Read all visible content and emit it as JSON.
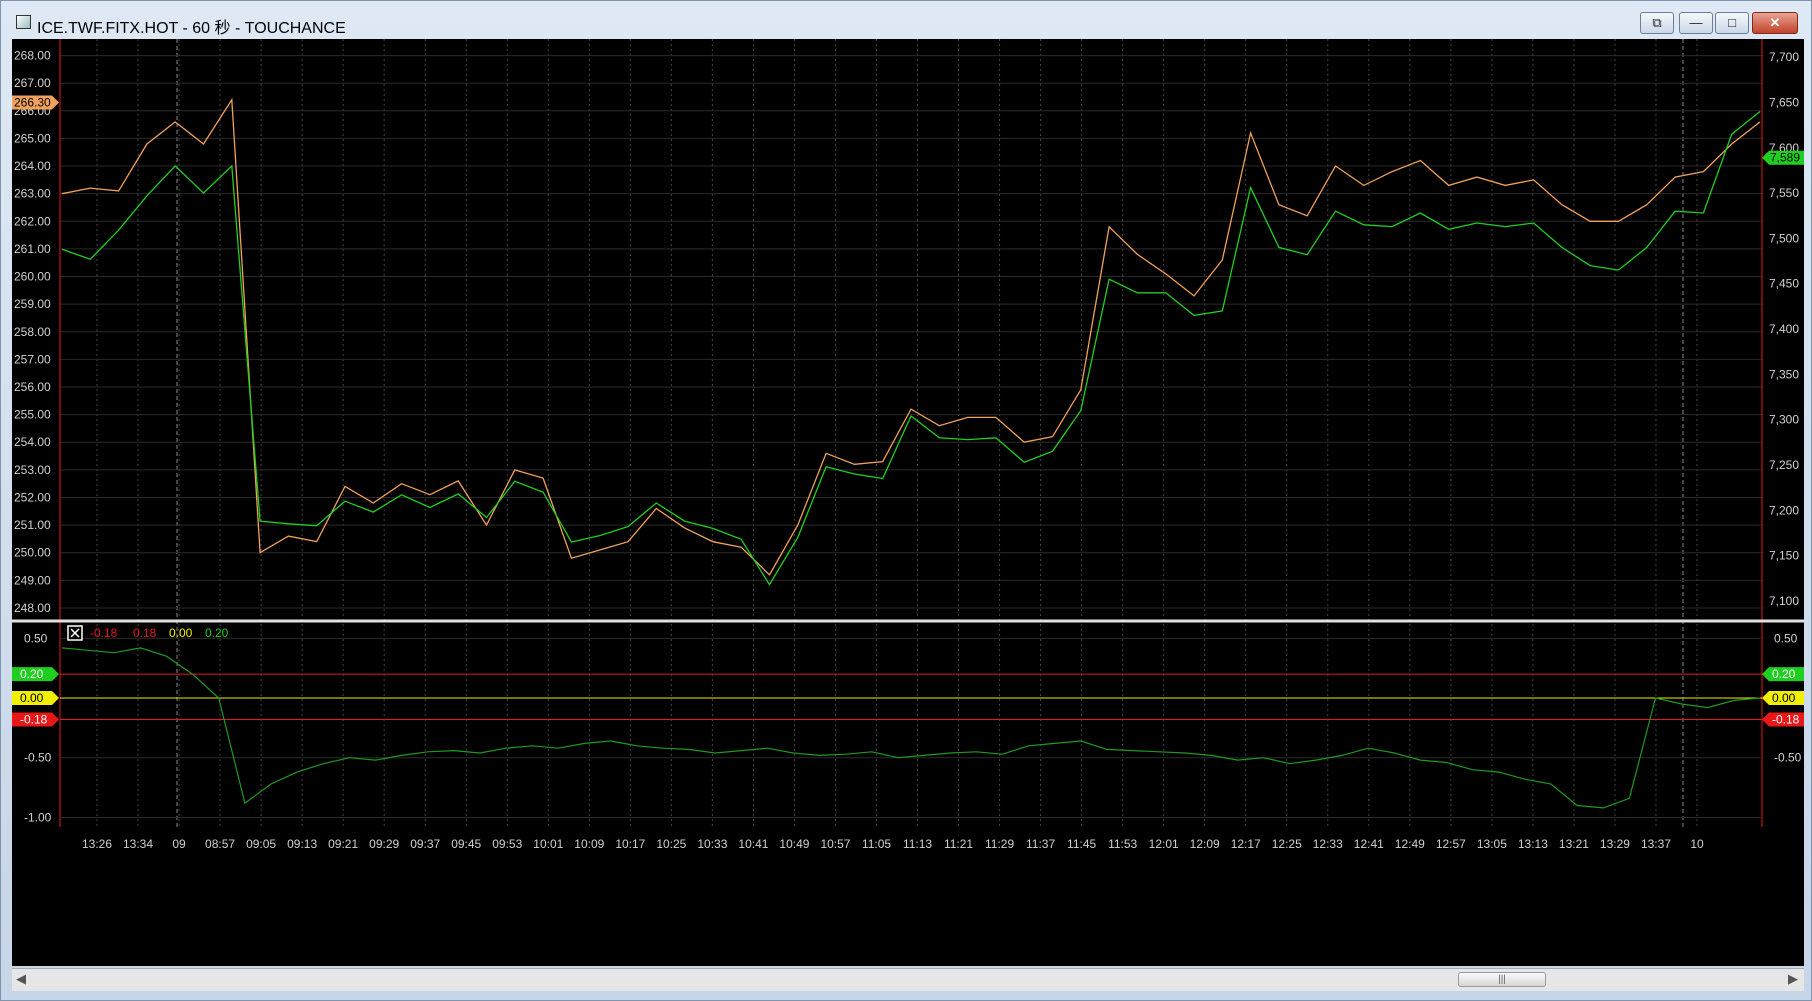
{
  "window": {
    "title": "ICE.TWF.FITX.HOT - 60 秒 - TOUCHANCE",
    "icon": "chart-app-icon",
    "buttons": {
      "restore_extra": "⧉",
      "minimize": "—",
      "maximize": "□",
      "close": "✕"
    }
  },
  "colors": {
    "orange": "#f0a15a",
    "green": "#1fcf1f",
    "red": "#e81818",
    "yellow": "#f0f000",
    "grid": "#444444",
    "axis_text": "#d0d0d0",
    "background": "#000000"
  },
  "chart_data": [
    {
      "type": "line",
      "panel": "main",
      "x_labels": [
        "13:26",
        "13:34",
        "09",
        "08:57",
        "09:05",
        "09:13",
        "09:21",
        "09:29",
        "09:37",
        "09:45",
        "09:53",
        "10:01",
        "10:09",
        "10:17",
        "10:25",
        "10:33",
        "10:41",
        "10:49",
        "10:57",
        "11:05",
        "11:13",
        "11:21",
        "11:29",
        "11:37",
        "11:45",
        "11:53",
        "12:01",
        "12:09",
        "12:17",
        "12:25",
        "12:33",
        "12:41",
        "12:49",
        "12:57",
        "13:05",
        "13:13",
        "13:21",
        "13:29",
        "13:37",
        "10"
      ],
      "left_axis": {
        "ticks": [
          "268.00",
          "267.00",
          "266.00",
          "265.00",
          "264.00",
          "263.00",
          "262.00",
          "261.00",
          "260.00",
          "259.00",
          "258.00",
          "257.00",
          "256.00",
          "255.00",
          "254.00",
          "253.00",
          "252.00",
          "251.00",
          "250.00",
          "249.00",
          "248.00"
        ],
        "ylim": [
          247.6,
          268.6
        ]
      },
      "right_axis": {
        "ticks": [
          "7,700",
          "7,650",
          "7,600",
          "7,550",
          "7,500",
          "7,450",
          "7,400",
          "7,350",
          "7,300",
          "7,250",
          "7,200",
          "7,150",
          "7,100"
        ],
        "ylim": [
          7080,
          7720
        ]
      },
      "last_value_labels": {
        "left": "266.30",
        "right": "7,589"
      },
      "series": [
        {
          "color": "#f0a15a",
          "axis": "left",
          "values": [
            263.0,
            263.2,
            263.1,
            264.8,
            265.6,
            264.8,
            266.4,
            250.0,
            250.6,
            250.4,
            252.4,
            251.8,
            252.5,
            252.1,
            252.6,
            251.0,
            253.0,
            252.7,
            249.8,
            250.1,
            250.4,
            251.6,
            250.9,
            250.4,
            250.2,
            249.2,
            251.0,
            253.6,
            253.2,
            253.3,
            255.2,
            254.6,
            254.9,
            254.9,
            254.0,
            254.2,
            255.9,
            261.8,
            260.8,
            260.1,
            259.3,
            260.6,
            265.2,
            262.6,
            262.2,
            264.0,
            263.3,
            263.8,
            264.2,
            263.3,
            263.6,
            263.3,
            263.5,
            262.6,
            262.0,
            262.0,
            262.6,
            263.6,
            263.8,
            264.8,
            265.6
          ]
        },
        {
          "color": "#1fcf1f",
          "axis": "right",
          "values": [
            7488,
            7477,
            7509,
            7547,
            7580,
            7550,
            7580,
            7188,
            7185,
            7183,
            7210,
            7198,
            7217,
            7203,
            7218,
            7192,
            7232,
            7220,
            7165,
            7172,
            7182,
            7208,
            7188,
            7180,
            7168,
            7118,
            7170,
            7248,
            7240,
            7235,
            7304,
            7280,
            7278,
            7280,
            7253,
            7265,
            7310,
            7455,
            7440,
            7440,
            7415,
            7420,
            7556,
            7490,
            7482,
            7530,
            7515,
            7513,
            7528,
            7510,
            7517,
            7513,
            7517,
            7490,
            7470,
            7465,
            7490,
            7530,
            7528,
            7615,
            7640
          ]
        }
      ]
    },
    {
      "type": "line",
      "panel": "indicator",
      "legend": [
        "-0.18",
        "0.18",
        "0.00",
        "0.20"
      ],
      "legend_colors": [
        "#e81818",
        "#e81818",
        "#f0f000",
        "#1fcf1f"
      ],
      "left_axis": {
        "ticks": [
          "0.50",
          "-0.50",
          "-1.00"
        ],
        "ylim": [
          -1.08,
          0.62
        ]
      },
      "right_axis": {
        "ticks": [
          "0.50",
          "-0.50"
        ]
      },
      "reference_lines": [
        {
          "value": 0.2,
          "label": "0.20",
          "color": "#1fcf1f",
          "line_color": "#e81818"
        },
        {
          "value": 0.0,
          "label": "0.00",
          "color": "#f0f000",
          "line_color": "#f0f000"
        },
        {
          "value": -0.18,
          "label": "-0.18",
          "color": "#e81818",
          "line_color": "#e81818"
        }
      ],
      "series": [
        {
          "color": "#1f9a1f",
          "values": [
            0.42,
            0.4,
            0.38,
            0.42,
            0.35,
            0.2,
            0.0,
            -0.88,
            -0.72,
            -0.62,
            -0.55,
            -0.5,
            -0.52,
            -0.48,
            -0.45,
            -0.44,
            -0.46,
            -0.42,
            -0.4,
            -0.42,
            -0.38,
            -0.36,
            -0.4,
            -0.42,
            -0.43,
            -0.46,
            -0.44,
            -0.42,
            -0.46,
            -0.48,
            -0.47,
            -0.45,
            -0.5,
            -0.48,
            -0.46,
            -0.45,
            -0.47,
            -0.4,
            -0.38,
            -0.36,
            -0.43,
            -0.44,
            -0.45,
            -0.46,
            -0.48,
            -0.52,
            -0.5,
            -0.55,
            -0.52,
            -0.48,
            -0.42,
            -0.46,
            -0.52,
            -0.54,
            -0.6,
            -0.62,
            -0.68,
            -0.72,
            -0.9,
            -0.92,
            -0.84,
            0.0,
            -0.05,
            -0.08,
            -0.02,
            0.0
          ]
        }
      ]
    }
  ],
  "scrollbar": {
    "left_arrow": "◀",
    "right_arrow": "▶",
    "grip": "|||"
  }
}
